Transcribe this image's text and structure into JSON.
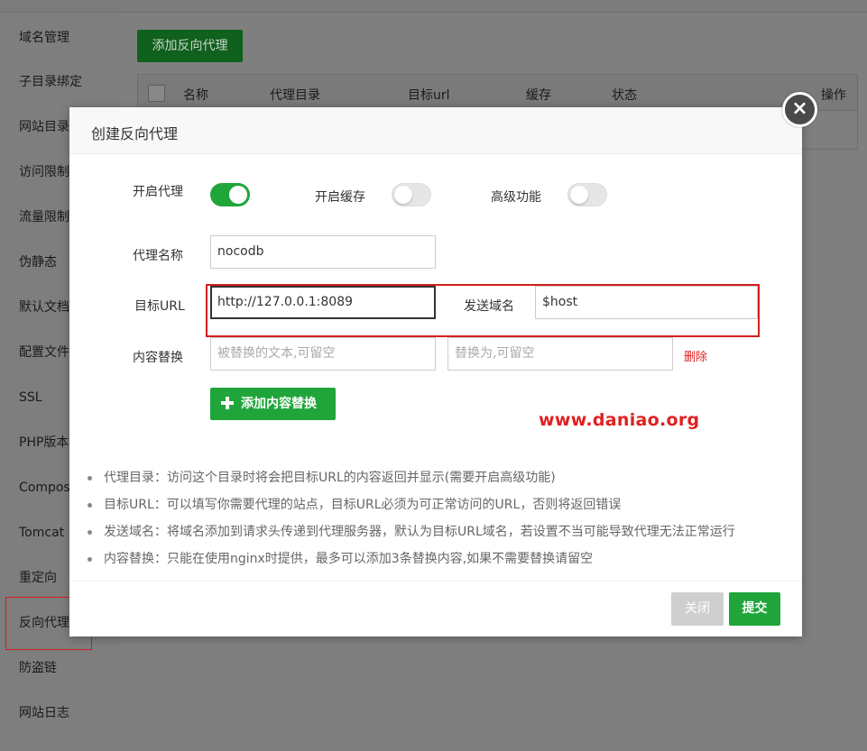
{
  "sidebar": {
    "items": [
      {
        "label": "域名管理"
      },
      {
        "label": "子目录绑定"
      },
      {
        "label": "网站目录"
      },
      {
        "label": "访问限制"
      },
      {
        "label": "流量限制"
      },
      {
        "label": "伪静态"
      },
      {
        "label": "默认文档"
      },
      {
        "label": "配置文件"
      },
      {
        "label": "SSL"
      },
      {
        "label": "PHP版本"
      },
      {
        "label": "Composer"
      },
      {
        "label": "Tomcat"
      },
      {
        "label": "重定向"
      },
      {
        "label": "反向代理"
      },
      {
        "label": "防盗链"
      },
      {
        "label": "网站日志"
      }
    ]
  },
  "background": {
    "add_button": "添加反向代理",
    "table_headers": [
      "名称",
      "代理目录",
      "目标url",
      "缓存",
      "状态",
      "操作"
    ]
  },
  "modal": {
    "title": "创建反向代理",
    "close_icon": "×",
    "toggles": {
      "enable_proxy": {
        "label": "开启代理",
        "on": true
      },
      "enable_cache": {
        "label": "开启缓存",
        "on": false
      },
      "advanced": {
        "label": "高级功能",
        "on": false
      }
    },
    "proxy_name": {
      "label": "代理名称",
      "value": "nocodb"
    },
    "target_url": {
      "label": "目标URL",
      "value": "http://127.0.0.1:8089"
    },
    "send_domain": {
      "label": "发送域名",
      "value": "$host"
    },
    "content_replace": {
      "label": "内容替换",
      "from_placeholder": "被替换的文本,可留空",
      "to_placeholder": "替换为,可留空",
      "delete_label": "删除"
    },
    "add_replace_button": "添加内容替换",
    "watermark": "www.daniao.org",
    "notes": [
      "代理目录：访问这个目录时将会把目标URL的内容返回并显示(需要开启高级功能)",
      "目标URL：可以填写你需要代理的站点，目标URL必须为可正常访问的URL，否则将返回错误",
      "发送域名：将域名添加到请求头传递到代理服务器，默认为目标URL域名，若设置不当可能导致代理无法正常运行",
      "内容替换：只能在使用nginx时提供，最多可以添加3条替换内容,如果不需要替换请留空"
    ],
    "footer": {
      "close_label": "关闭",
      "submit_label": "提交"
    }
  },
  "colors": {
    "accent_green": "#20a53a",
    "annotation_red": "#d21e1e"
  }
}
